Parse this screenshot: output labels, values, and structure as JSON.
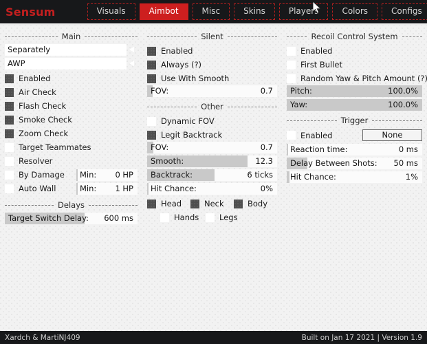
{
  "header": {
    "logo": "Sensum",
    "tabs": [
      {
        "label": "Visuals",
        "active": false
      },
      {
        "label": "Aimbot",
        "active": true
      },
      {
        "label": "Misc",
        "active": false
      },
      {
        "label": "Skins",
        "active": false
      },
      {
        "label": "Players",
        "active": false
      },
      {
        "label": "Colors",
        "active": false
      },
      {
        "label": "Configs",
        "active": false
      }
    ],
    "accent_color": "#cd1f1f",
    "logo_color": "#c31f1f",
    "bar_color": "#17181a"
  },
  "main": {
    "section_title": "Main",
    "mode_combo": {
      "value": "Separately",
      "icon": "chevron-left-icon"
    },
    "weapon_combo": {
      "value": "AWP",
      "icon": "chevron-left-icon"
    },
    "checks": [
      {
        "label": "Enabled",
        "checked": true
      },
      {
        "label": "Air Check",
        "checked": true
      },
      {
        "label": "Flash Check",
        "checked": true
      },
      {
        "label": "Smoke Check",
        "checked": true
      },
      {
        "label": "Zoom Check",
        "checked": true
      },
      {
        "label": "Target Teammates",
        "checked": false
      },
      {
        "label": "Resolver",
        "checked": false
      }
    ],
    "by_damage": {
      "label": "By Damage",
      "checked": false,
      "slider_label": "Min:",
      "value": "0 HP",
      "fill_pct": 2
    },
    "auto_wall": {
      "label": "Auto Wall",
      "checked": false,
      "slider_label": "Min:",
      "value": "1 HP",
      "fill_pct": 2
    },
    "delays_title": "Delays",
    "target_switch_delay": {
      "label": "Target Switch Delay:",
      "value": "600 ms",
      "fill_pct": 60
    }
  },
  "silent": {
    "section_title": "Silent",
    "checks": [
      {
        "label": "Enabled",
        "checked": true
      },
      {
        "label": "Always (?)",
        "checked": true
      },
      {
        "label": "Use With Smooth",
        "checked": true
      }
    ],
    "fov": {
      "label": "FOV:",
      "value": "0.7",
      "fill_pct": 4
    }
  },
  "other": {
    "section_title": "Other",
    "checks": [
      {
        "label": "Dynamic FOV",
        "checked": false
      },
      {
        "label": "Legit Backtrack",
        "checked": true
      }
    ],
    "sliders": [
      {
        "label": "FOV:",
        "value": "0.7",
        "fill_pct": 5
      },
      {
        "label": "Smooth:",
        "value": "12.3",
        "fill_pct": 77
      },
      {
        "label": "Backtrack:",
        "value": "6 ticks",
        "fill_pct": 52
      },
      {
        "label": "Hit Chance:",
        "value": "0%",
        "fill_pct": 1
      }
    ],
    "hitboxes_row1": [
      {
        "label": "Head",
        "checked": true
      },
      {
        "label": "Neck",
        "checked": true
      },
      {
        "label": "Body",
        "checked": true
      }
    ],
    "hitboxes_row2": [
      {
        "label": "Hands",
        "checked": false
      },
      {
        "label": "Legs",
        "checked": false
      }
    ]
  },
  "rcs": {
    "section_title": "Recoil Control System",
    "checks": [
      {
        "label": "Enabled",
        "checked": false
      },
      {
        "label": "First Bullet",
        "checked": false
      },
      {
        "label": "Random Yaw & Pitch Amount (?)",
        "checked": false
      }
    ],
    "sliders": [
      {
        "label": "Pitch:",
        "value": "100.0%",
        "fill_pct": 100
      },
      {
        "label": "Yaw:",
        "value": "100.0%",
        "fill_pct": 100
      }
    ]
  },
  "trigger": {
    "section_title": "Trigger",
    "enabled": {
      "label": "Enabled",
      "checked": false
    },
    "keybind": "None",
    "sliders": [
      {
        "label": "Reaction time:",
        "value": "0 ms",
        "fill_pct": 1
      },
      {
        "label": "Delay Between Shots:",
        "value": "50 ms",
        "fill_pct": 15
      },
      {
        "label": "Hit Chance:",
        "value": "1%",
        "fill_pct": 2
      }
    ]
  },
  "footer": {
    "credits": "Xardch & MartiNJ409",
    "build": "Built on Jan 17 2021 | Version 1.9"
  }
}
